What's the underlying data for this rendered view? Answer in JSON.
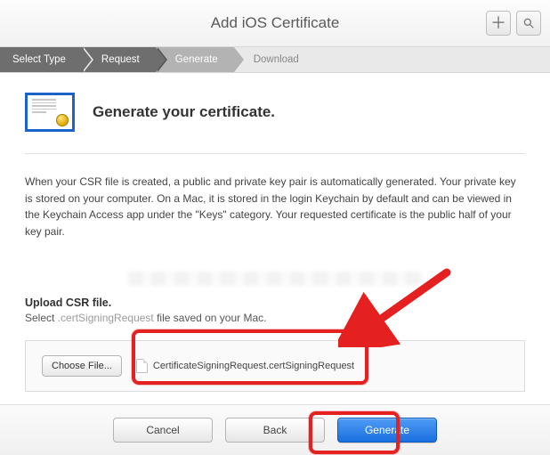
{
  "titlebar": {
    "title": "Add iOS Certificate"
  },
  "steps": {
    "items": [
      {
        "label": "Select Type",
        "state": "done"
      },
      {
        "label": "Request",
        "state": "done"
      },
      {
        "label": "Generate",
        "state": "current"
      },
      {
        "label": "Download",
        "state": "pending"
      }
    ]
  },
  "heading": "Generate your certificate.",
  "body_html": "When your CSR file is created, a public and private key pair is automatically generated. Your private key is stored on your computer. On a Mac, it is stored in the login Keychain by default and can be viewed in the Keychain Access app under the \"Keys\" category. Your requested certificate is the public half of your key pair.",
  "upload": {
    "title": "Upload CSR file.",
    "sub_pre": "Select ",
    "sub_ext": ".certSigningRequest",
    "sub_post": " file saved on your Mac.",
    "choose_label": "Choose File...",
    "filename": "CertificateSigningRequest.certSigningRequest"
  },
  "footer": {
    "cancel": "Cancel",
    "back": "Back",
    "generate": "Generate"
  },
  "colors": {
    "accent": "#1a6fe0",
    "annotation": "#e52020"
  }
}
